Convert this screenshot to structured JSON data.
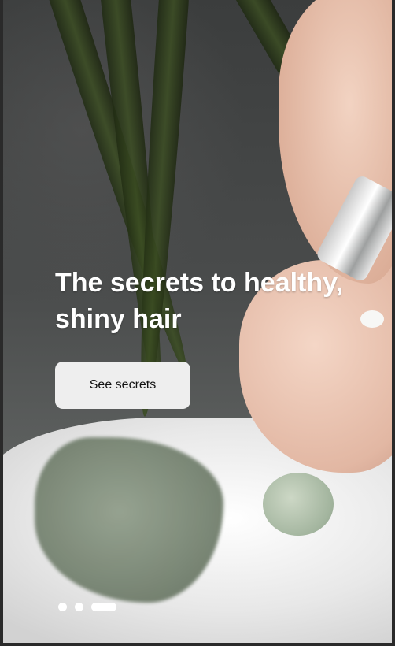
{
  "hero": {
    "headline": "The secrets to healthy, shiny hair",
    "cta_label": "See secrets"
  },
  "carousel": {
    "total": 3,
    "active_index": 2
  },
  "colors": {
    "headline_text": "#ffffff",
    "button_bg": "#eeeeee",
    "button_text": "#111111",
    "indicator": "#ffffff"
  }
}
